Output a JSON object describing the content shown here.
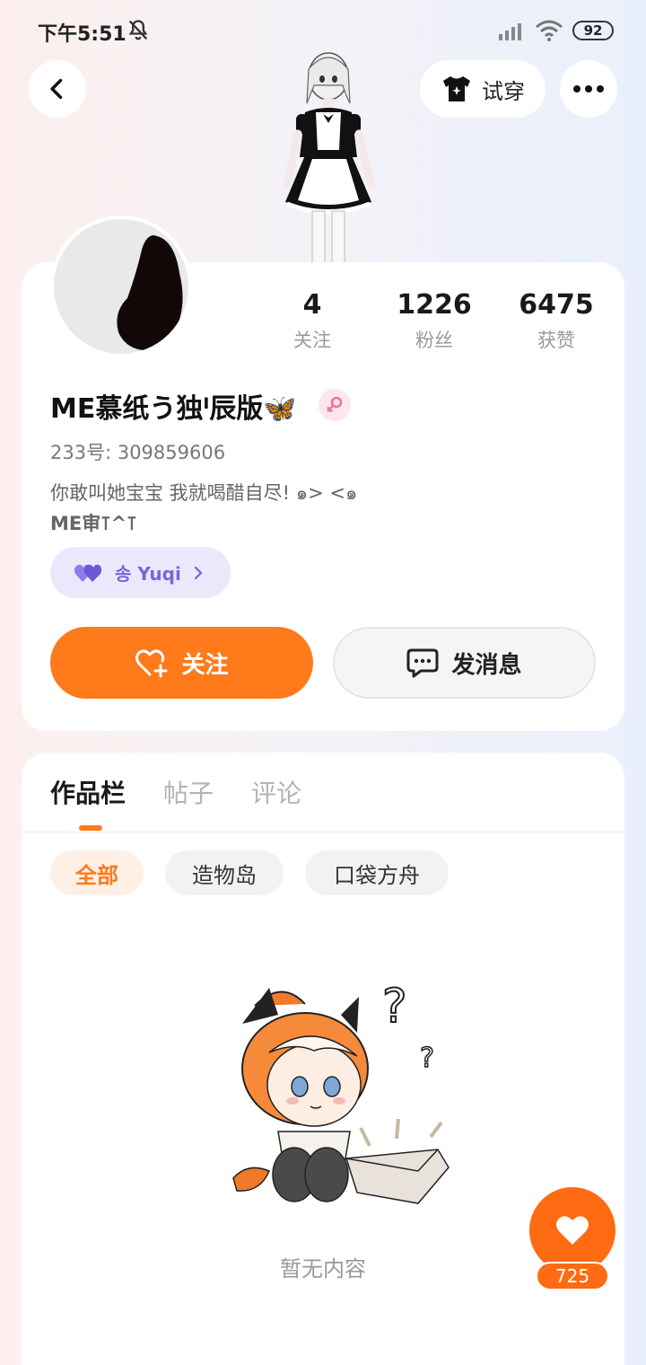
{
  "status_bar": {
    "time": "下午5:51",
    "battery": "92"
  },
  "header": {
    "try_on_label": "试穿"
  },
  "profile": {
    "stats": [
      {
        "value": "4",
        "label": "关注"
      },
      {
        "value": "1226",
        "label": "粉丝"
      },
      {
        "value": "6475",
        "label": "获赞"
      }
    ],
    "username": "ME慕纸う独ᴵ辰版🦋",
    "uid": "233号: 309859606",
    "bio_line1": "你敢叫她宝宝 我就喝醋自尽! ๑> <๑",
    "bio_line2": "ME审⊺^⊺",
    "fan_pill_label": "송 Yuqi",
    "follow_label": "关注",
    "message_label": "发消息"
  },
  "works": {
    "tabs": [
      "作品栏",
      "帖子",
      "评论"
    ],
    "chips": [
      "全部",
      "造物岛",
      "口袋方舟"
    ],
    "empty_text": "暂无内容"
  },
  "fab": {
    "count": "725"
  },
  "colors": {
    "accent": "#ff7a1a",
    "fan_pill_bg": "#eae8fb",
    "fan_pill_text": "#7667d8"
  }
}
